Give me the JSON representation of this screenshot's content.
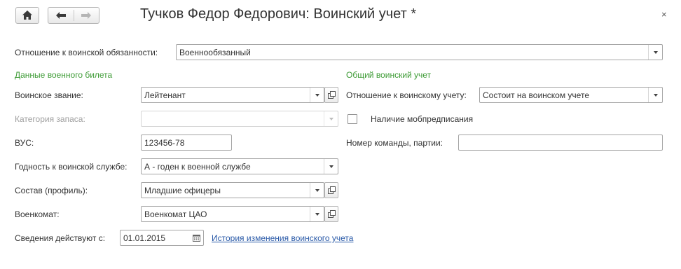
{
  "window": {
    "title": "Тучков Федор Федорович: Воинский учет *",
    "close_glyph": "×"
  },
  "toolbar": {
    "home_icon": "home-icon",
    "back_icon": "arrow-left-icon",
    "forward_icon": "arrow-right-icon"
  },
  "form": {
    "attitude": {
      "label": "Отношение к воинской обязанности:",
      "value": "Военнообязанный"
    },
    "military_id_section": "Данные военного билета",
    "rank": {
      "label": "Воинское звание:",
      "value": "Лейтенант"
    },
    "reserve_category": {
      "label": "Категория запаса:",
      "value": ""
    },
    "vus": {
      "label": "ВУС:",
      "value": "123456-78"
    },
    "fitness": {
      "label": "Годность к воинской службе:",
      "value": "А - годен к военной службе"
    },
    "profile": {
      "label": "Состав (профиль):",
      "value": "Младшие офицеры"
    },
    "commissariat": {
      "label": "Военкомат:",
      "value": "Военкомат ЦАО"
    },
    "valid_from": {
      "label": "Сведения действуют с:",
      "value": "01.01.2015"
    },
    "history_link": "История изменения воинского учета",
    "general_section": "Общий воинский учет",
    "registration": {
      "label": "Отношение к воинскому учету:",
      "value": "Состоит на воинском учете"
    },
    "mobilization": {
      "label": "Наличие мобпредписания",
      "checked": false
    },
    "team_number": {
      "label": "Номер команды, партии:",
      "value": ""
    }
  },
  "colors": {
    "section_header": "#3d9b35",
    "link": "#2a5aa8",
    "disabled_text": "#a0a0a0"
  }
}
